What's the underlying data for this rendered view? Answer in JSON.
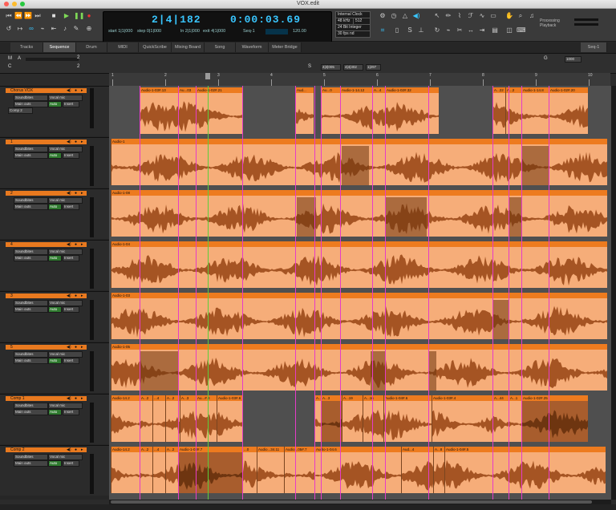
{
  "window": {
    "title": "VOX.edit"
  },
  "toolbar": {
    "transport_icons": [
      "rewind-to-start-icon",
      "rewind-icon",
      "fast-forward-icon",
      "go-to-end-icon",
      "stop-icon",
      "play-icon",
      "pause-icon",
      "record-icon"
    ],
    "bars_beats": "2|4|182",
    "time": "0:00:03.69",
    "start_label": "start 1|1|000",
    "step_label": "step 0|1|000",
    "ln_label": "ln 2|1|000",
    "exit_label": "exit 4|1|000",
    "seq_label": "Seq-1",
    "tempo_label": "120.00",
    "clock_source": "Internal Clock",
    "sample_rate": "48 kHz",
    "buffer": "512",
    "bit_depth": "24 Bit Integer",
    "frame_rate": "30 fps nd",
    "processing_label": "Processing",
    "playback_label": "Playback"
  },
  "tabs": [
    {
      "label": "Tracks"
    },
    {
      "label": "Sequence"
    },
    {
      "label": "Drum"
    },
    {
      "label": "MIDI"
    },
    {
      "label": "QuickScribe"
    },
    {
      "label": "Mixing Board"
    },
    {
      "label": "Song"
    },
    {
      "label": "Waveform"
    },
    {
      "label": "Meter Bridge"
    }
  ],
  "active_tab": "Sequence",
  "sequence_menu": "Seq-1",
  "control_bar": {
    "m_label": "M",
    "a_label": "A",
    "c_label": "C",
    "s_label": "S",
    "field1": "4|3|005",
    "field2": "4|4|302",
    "field3": "1|297",
    "zoom": "1000",
    "zoom_g": "G",
    "r_value": "2",
    "r_value2": "2"
  },
  "ruler_labels": [
    "1",
    "2",
    "3",
    "4",
    "5",
    "6",
    "7",
    "8",
    "9",
    "10"
  ],
  "tracks": [
    {
      "name": "Chorus VOX",
      "input": "Soundbites",
      "mic": "Vocal mic",
      "output": "Main outs",
      "mode": "Auto",
      "insert": "Insert",
      "extra": "Comp 2"
    },
    {
      "name": "1",
      "input": "Soundbites",
      "mic": "Vocal mic",
      "output": "Main outs",
      "mode": "Auto",
      "insert": "Insert"
    },
    {
      "name": "2",
      "input": "Soundbites",
      "mic": "Vocal mic",
      "output": "Main outs",
      "mode": "Auto",
      "insert": "Insert"
    },
    {
      "name": "4",
      "input": "Soundbites",
      "mic": "Vocal mic",
      "output": "Main outs",
      "mode": "Auto",
      "insert": "Insert"
    },
    {
      "name": "3",
      "input": "Soundbites",
      "mic": "Vocal mic",
      "output": "Main outs",
      "mode": "Auto",
      "insert": "Insert"
    },
    {
      "name": "5",
      "input": "Soundbites",
      "mic": "Vocal mic",
      "output": "Main outs",
      "mode": "Auto",
      "insert": "Insert"
    },
    {
      "name": "Comp 1",
      "input": "Soundbites",
      "mic": "Vocal mic",
      "output": "Main outs",
      "mode": "Auto",
      "insert": "Insert"
    },
    {
      "name": "Comp 2",
      "input": "Soundbites",
      "mic": "Vocal mic",
      "output": "Main outs",
      "mode": "Auto",
      "insert": "Insert"
    }
  ],
  "clip_names": {
    "chorus": [
      "Audio-1-03#.13",
      "Au...03",
      "Audio-1-02#.21",
      "Aud...",
      "Au...0",
      "Audio-1-14.12",
      "A...4",
      "Audio-1-02#.32",
      "A...22",
      "A...2",
      "Audio-1-14.8",
      "Audio-1-02#.20"
    ],
    "t1": "Audio-1",
    "t2": "Audio-1-08",
    "t4": "Audio-1-04",
    "t3": "Audio-1-03",
    "t5": "Audio-1-05",
    "comp1": [
      "Audio-14.2",
      "A...2",
      "...4",
      "A...2",
      "A...3",
      "Au...#.8",
      "Audio-1-03#.6",
      "A...1",
      "A...3",
      "A...19",
      "A...16",
      "Audio-1-04#.6",
      "Audio-1-03#.4",
      "A...44",
      "A...1",
      "Audio-1-02#.25"
    ],
    "comp2": [
      "Audio-14.2",
      "A...2",
      "...4",
      "A...2",
      "Audio-1-03#.7",
      "...0",
      "Audio...34.11",
      "Audio...05#.7",
      "Audio-1-04.6",
      "Aud...4",
      "A...8",
      "Audio-1-04#.5"
    ]
  }
}
